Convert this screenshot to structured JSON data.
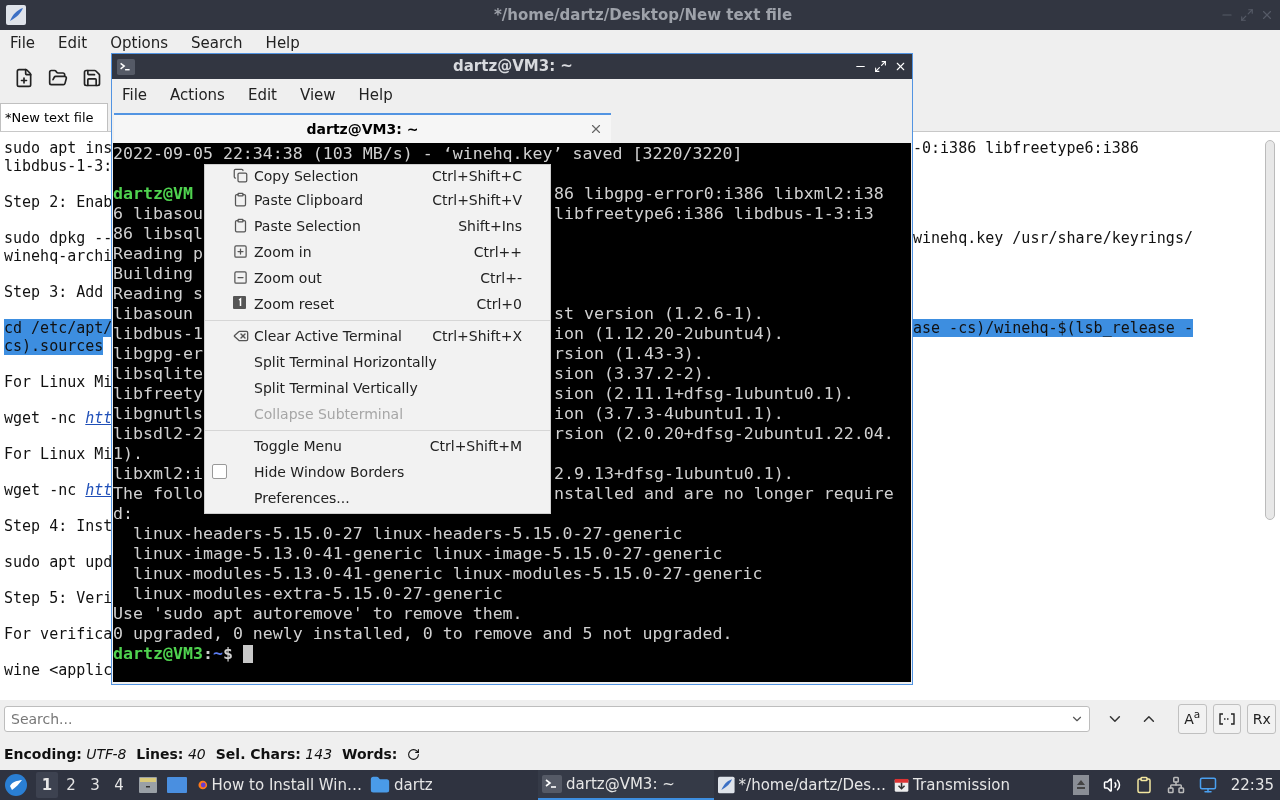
{
  "editor": {
    "title": "*/home/dartz/Desktop/New text file",
    "menu": [
      "File",
      "Edit",
      "Options",
      "Search",
      "Help"
    ],
    "tab": {
      "label": "*New text file",
      "selected": true
    },
    "lines": [
      {
        "kind": "text",
        "left": "sudo apt ins",
        "right": "-0:i386 libfreetype6:i386",
        "selected": false
      },
      {
        "kind": "text",
        "left": "libdbus-1-3:",
        "selected": false
      },
      {
        "kind": "blank"
      },
      {
        "kind": "text",
        "left": "Step 2: Enab",
        "selected": false
      },
      {
        "kind": "blank"
      },
      {
        "kind": "text",
        "left": "sudo dpkg --",
        "right": "winehq.key /usr/share/keyrings/",
        "selected": false
      },
      {
        "kind": "text",
        "left": "winehq-archi",
        "selected": false
      },
      {
        "kind": "blank"
      },
      {
        "kind": "text",
        "left": "Step 3: Add",
        "selected": false
      },
      {
        "kind": "blank"
      },
      {
        "kind": "text",
        "left": "cd /etc/apt/",
        "right": "ase -cs)/winehq-$(lsb_release -",
        "selected": true
      },
      {
        "kind": "text",
        "left": "cs).sources",
        "selected": true
      },
      {
        "kind": "blank"
      },
      {
        "kind": "text",
        "left": "For Linux Mi",
        "selected": false
      },
      {
        "kind": "blank"
      },
      {
        "kind": "link",
        "left": "wget -nc ",
        "link": "htt",
        "selected": false
      },
      {
        "kind": "blank"
      },
      {
        "kind": "text",
        "left": "For Linux Mi",
        "selected": false
      },
      {
        "kind": "blank"
      },
      {
        "kind": "link",
        "left": "wget -nc ",
        "link": "htt",
        "selected": false
      },
      {
        "kind": "blank"
      },
      {
        "kind": "text",
        "left": "Step 4: Inst",
        "selected": false
      },
      {
        "kind": "blank"
      },
      {
        "kind": "text",
        "left": "sudo apt upd",
        "selected": false
      },
      {
        "kind": "blank"
      },
      {
        "kind": "text",
        "left": "Step 5: Veri",
        "selected": false
      },
      {
        "kind": "blank"
      },
      {
        "kind": "text",
        "left": "For verifica",
        "selected": false
      },
      {
        "kind": "blank"
      },
      {
        "kind": "text",
        "left": "wine <applic",
        "selected": false
      }
    ],
    "search": {
      "placeholder": "Search...",
      "options": [
        {
          "kind": "text",
          "label": "A$^{a}$"
        },
        {
          "kind": "icon"
        },
        {
          "kind": "text",
          "label": "Rx"
        }
      ]
    },
    "status": [
      {
        "label": "Encoding:",
        "value": "UTF-8"
      },
      {
        "label": "Lines:",
        "value": "40"
      },
      {
        "label": "Sel. Chars:",
        "value": "143"
      },
      {
        "label": "Words:"
      }
    ]
  },
  "terminal": {
    "title": "dartz@VM3: ~",
    "menu": [
      "File",
      "Actions",
      "Edit",
      "View",
      "Help"
    ],
    "tab": {
      "label": "dartz@VM3: ~",
      "selected": true
    },
    "rows": [
      {
        "kind": "text",
        "text": "2022-09-05 22:34:38 (103 MB/s) - ‘winehq.key’ saved [3220/3220]"
      },
      {
        "kind": "blank"
      },
      {
        "kind": "split",
        "left": "dartz@VM",
        "prompt": true,
        "right": "86 libgpg-error0:i386 libxml2:i38"
      },
      {
        "kind": "split",
        "left": "6 libasou",
        "prompt": false,
        "right": "libfreetype6:i386 libdbus-1-3:i3"
      },
      {
        "kind": "split",
        "left": "86 libsql",
        "prompt": false
      },
      {
        "kind": "split",
        "left": "Reading p",
        "prompt": false
      },
      {
        "kind": "split",
        "left": "Building",
        "prompt": false
      },
      {
        "kind": "split",
        "left": "Reading s",
        "prompt": false
      },
      {
        "kind": "split",
        "left": "libasoun",
        "prompt": false,
        "right": "st version (1.2.6-1)."
      },
      {
        "kind": "split",
        "left": "libdbus-1",
        "prompt": false,
        "right": "ion (1.12.20-2ubuntu4)."
      },
      {
        "kind": "split",
        "left": "libgpg-er",
        "prompt": false,
        "right": "rsion (1.43-3)."
      },
      {
        "kind": "split",
        "left": "libsqlite",
        "prompt": false,
        "right": "sion (3.37.2-2)."
      },
      {
        "kind": "split",
        "left": "libfreety",
        "prompt": false,
        "right": "sion (2.11.1+dfsg-1ubuntu0.1)."
      },
      {
        "kind": "split",
        "left": "libgnutls",
        "prompt": false,
        "right": "ion (3.7.3-4ubuntu1.1)."
      },
      {
        "kind": "split",
        "left": "libsdl2-2",
        "prompt": false,
        "right": "rsion (2.0.20+dfsg-2ubuntu1.22.04."
      },
      {
        "kind": "split",
        "left": "1).",
        "prompt": false
      },
      {
        "kind": "split",
        "left": "libxml2:i",
        "prompt": false,
        "right": "2.9.13+dfsg-1ubuntu0.1)."
      },
      {
        "kind": "split",
        "left": "The follo",
        "prompt": false,
        "right": "nstalled and are no longer require"
      },
      {
        "kind": "text",
        "text": "d:"
      },
      {
        "kind": "text",
        "text": "  linux-headers-5.15.0-27 linux-headers-5.15.0-27-generic"
      },
      {
        "kind": "text",
        "text": "  linux-image-5.13.0-41-generic linux-image-5.15.0-27-generic"
      },
      {
        "kind": "text",
        "text": "  linux-modules-5.13.0-41-generic linux-modules-5.15.0-27-generic"
      },
      {
        "kind": "text",
        "text": "  linux-modules-extra-5.15.0-27-generic"
      },
      {
        "kind": "text",
        "text": "Use 'sudo apt autoremove' to remove them."
      },
      {
        "kind": "text",
        "text": "0 upgraded, 0 newly installed, 0 to remove and 5 not upgraded."
      },
      {
        "kind": "prompt",
        "user": "dartz@VM3",
        "sep": ":",
        "path": "~",
        "symbol": "$"
      }
    ]
  },
  "context_menu": [
    {
      "kind": "item",
      "label": "Copy Selection",
      "shortcut": "Ctrl+Shift+C",
      "disabled": false
    },
    {
      "kind": "item",
      "label": "Paste Clipboard",
      "shortcut": "Ctrl+Shift+V",
      "disabled": false
    },
    {
      "kind": "item",
      "label": "Paste Selection",
      "shortcut": "Shift+Ins",
      "disabled": false
    },
    {
      "kind": "item",
      "label": "Zoom in",
      "shortcut": "Ctrl++",
      "disabled": false
    },
    {
      "kind": "item",
      "label": "Zoom out",
      "shortcut": "Ctrl+-",
      "disabled": false
    },
    {
      "kind": "item",
      "label": "Zoom reset",
      "shortcut": "Ctrl+0",
      "disabled": false
    },
    {
      "kind": "separator"
    },
    {
      "kind": "item",
      "label": "Clear Active Terminal",
      "shortcut": "Ctrl+Shift+X",
      "disabled": false
    },
    {
      "kind": "item",
      "label": "Split Terminal Horizontally",
      "disabled": false
    },
    {
      "kind": "item",
      "label": "Split Terminal Vertically",
      "disabled": false
    },
    {
      "kind": "item",
      "label": "Collapse Subterminal",
      "disabled": true
    },
    {
      "kind": "separator"
    },
    {
      "kind": "item",
      "label": "Toggle Menu",
      "shortcut": "Ctrl+Shift+M",
      "disabled": false
    },
    {
      "kind": "checkbox",
      "label": "Hide Window Borders",
      "checked": false,
      "disabled": false
    },
    {
      "kind": "item",
      "label": "Preferences...",
      "disabled": false
    }
  ],
  "taskbar": {
    "workspaces": [
      {
        "label": "1",
        "selected": true
      },
      {
        "label": "2",
        "selected": false
      },
      {
        "label": "3",
        "selected": false
      },
      {
        "label": "4",
        "selected": false
      }
    ],
    "tasks": [
      {
        "label": "How to Install Win…",
        "selected": false
      },
      {
        "label": "dartz",
        "selected": false
      },
      {
        "label": "dartz@VM3: ~",
        "selected": true
      },
      {
        "label": "*/home/dartz/Des…",
        "selected": false
      },
      {
        "label": "Transmission",
        "selected": false
      }
    ],
    "clock": "22:35"
  }
}
